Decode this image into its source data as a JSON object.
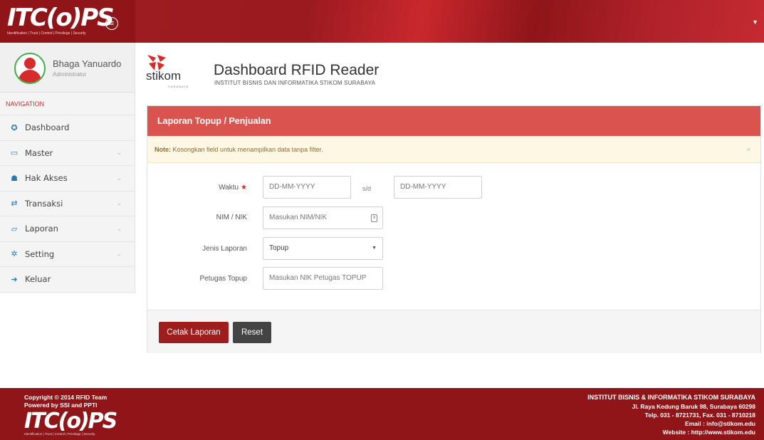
{
  "header": {
    "logo_text": "ITC(o)PS",
    "logo_tagline": "Identification | Trust | Control | Previlege | Security",
    "menu_icon": "menu-icon",
    "dropdown_icon": "caret-down-icon"
  },
  "profile": {
    "name": "Bhaga Yanuardo",
    "role": "Administrator"
  },
  "sidebar": {
    "section_label": "NAVIGATION",
    "items": [
      {
        "label": "Dashboard",
        "icon": "dashboard-icon",
        "has_submenu": false
      },
      {
        "label": "Master",
        "icon": "monitor-icon",
        "has_submenu": true
      },
      {
        "label": "Hak Akses",
        "icon": "users-icon",
        "has_submenu": true
      },
      {
        "label": "Transaksi",
        "icon": "exchange-icon",
        "has_submenu": true
      },
      {
        "label": "Laporan",
        "icon": "folder-icon",
        "has_submenu": true
      },
      {
        "label": "Setting",
        "icon": "gear-icon",
        "has_submenu": true
      },
      {
        "label": "Keluar",
        "icon": "sign-out-icon",
        "has_submenu": false
      }
    ]
  },
  "brand": {
    "word": "stikom",
    "city": "SURABAYA"
  },
  "page": {
    "title": "Dashboard RFID Reader",
    "subtitle": "INSTITUT BISNIS DAN INFORMATIKA STIKOM SURABAYA"
  },
  "panel": {
    "heading": "Laporan Topup / Penjualan",
    "note_bold": "Note:",
    "note_text": "Kosongkan field untuk menampilkan data tanpa filter.",
    "note_close": "×"
  },
  "form": {
    "waktu_label": "Waktu",
    "date_from_placeholder": "DD-MM-YYYY",
    "range_separator": "s/d",
    "date_to_placeholder": "DD-MM-YYYY",
    "nim_label": "NIM / NIK",
    "nim_placeholder": "Masukan NIM/NIK",
    "jenis_label": "Jenis Laporan",
    "jenis_value": "Topup",
    "petugas_label": "Petugas Topup",
    "petugas_placeholder": "Masukan NIK Petugas TOPUP"
  },
  "actions": {
    "print_label": "Cetak Laporan",
    "reset_label": "Reset"
  },
  "footer": {
    "copyright": "Copyright © 2014 RFID Team",
    "powered": "Powered by SSI and PPTI",
    "logo_text": "ITC(o)PS",
    "logo_tagline": "Identification | Trust | Control | Previlege | Security",
    "institution": "INSTITUT BISNIS & INFORMATIKA STIKOM SURABAYA",
    "address": "Jl. Raya Kedung Baruk 98, Surabaya 60298",
    "phone": "Telp. 031 - 8721731, Fax. 031 - 8710218",
    "email": "Email : info@stikom.edu",
    "website": "Website : http://www.stikom.edu"
  },
  "colors": {
    "brand_red": "#8f1519",
    "panel_heading": "#d9534f",
    "note_bg": "#fcf8e3",
    "nav_icon": "#2a79b6"
  }
}
